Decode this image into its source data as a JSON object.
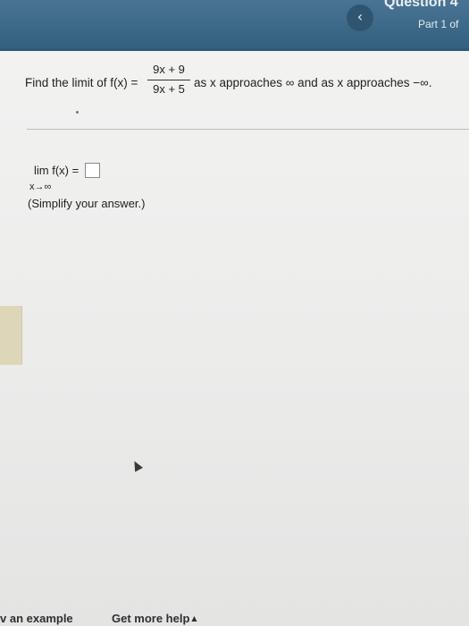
{
  "header": {
    "back_icon": "chevron-left-icon",
    "back_glyph": "‹",
    "question_title": "Question 4",
    "part_label": "Part 1 of"
  },
  "question": {
    "prompt_lead": "Find the limit of f(x) =",
    "numerator": "9x + 9",
    "denominator": "9x + 5",
    "prompt_tail": "as x approaches ∞ and as x approaches −∞."
  },
  "answer": {
    "lim_text": "lim  f(x) =",
    "lim_subscript": "x→∞",
    "input_value": "",
    "hint": "(Simplify your answer.)"
  },
  "footer": {
    "example_label": "v an example",
    "help_label": "Get more help",
    "help_caret_icon": "caret-up-icon",
    "help_caret": "▲"
  }
}
